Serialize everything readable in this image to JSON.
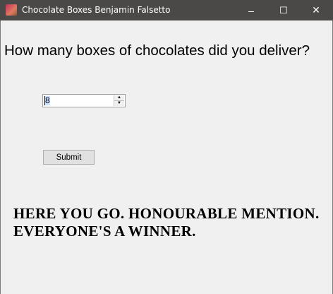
{
  "window": {
    "title": "Chocolate Boxes Benjamin Falsetto",
    "minimize": "–",
    "maximize": "☐",
    "close": "✕"
  },
  "form": {
    "question": "How many boxes of chocolates did you deliver?",
    "boxes_value": "8",
    "submit_label": "Submit",
    "result_line1": "Here you go. Honourable mention.",
    "result_line2": "Everyone's a winner."
  }
}
